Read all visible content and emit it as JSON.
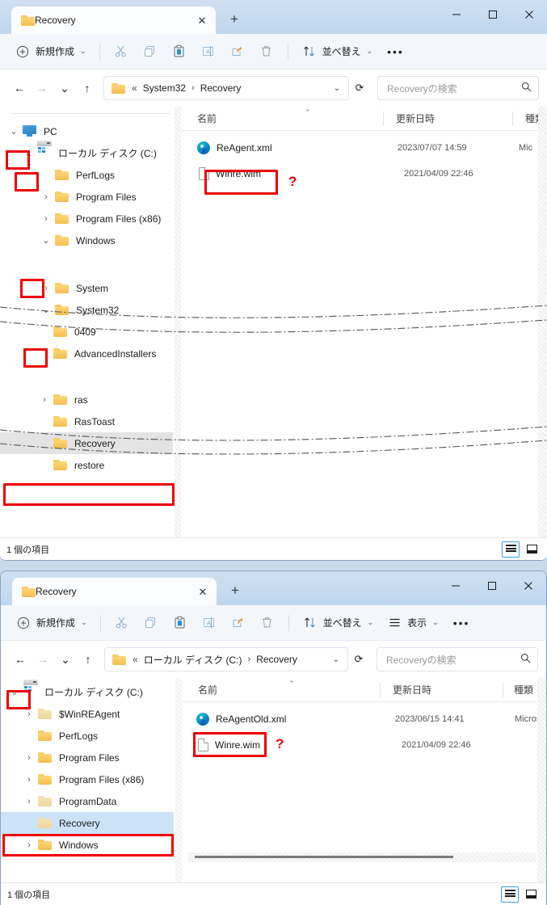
{
  "windows": [
    {
      "id": "window-system32-recovery",
      "tab": {
        "title": "Recovery",
        "close_label": "✕",
        "newtab_label": "+"
      },
      "window_controls": {
        "minimize": "–",
        "maximize": "□",
        "close": "✕"
      },
      "toolbar": {
        "new_label": "新規作成",
        "new_chevron": "⌄",
        "cut_label": "切り取り",
        "copy_label": "コピー",
        "paste_label": "貼り付け",
        "rename_label": "名前の変更",
        "share_label": "共有",
        "delete_label": "削除",
        "sort_label": "並べ替え",
        "sort_chevron": "⌄",
        "more_label": "•••"
      },
      "address": {
        "back": "←",
        "forward": "→",
        "recent": "⌄",
        "up": "↑",
        "crumb_prefix": "«",
        "crumbs": [
          "System32",
          "Recovery"
        ],
        "crumb_separator": "›",
        "dropdown": "⌄",
        "refresh": "⟳",
        "search_placeholder": "Recoveryの検索",
        "search_icon": "⚲"
      },
      "tree": [
        {
          "label": "PC",
          "indent": 1,
          "twisty": "down",
          "icon": "pc",
          "highlight_twisty": true
        },
        {
          "label": "ローカル ディスク (C:)",
          "indent": 2,
          "twisty": "down",
          "icon": "disk",
          "highlight_twisty": true
        },
        {
          "label": "PerfLogs",
          "indent": 3,
          "twisty": "none",
          "icon": "folder"
        },
        {
          "label": "Program Files",
          "indent": 3,
          "twisty": "right",
          "icon": "folder"
        },
        {
          "label": "Program Files (x86)",
          "indent": 3,
          "twisty": "right",
          "icon": "folder"
        },
        {
          "label": "Windows",
          "indent": 3,
          "twisty": "down",
          "icon": "folder",
          "highlight_twisty": true
        },
        {
          "label": "System",
          "indent": 3,
          "twisty": "right",
          "icon": "folder"
        },
        {
          "label": "System32",
          "indent": 3,
          "twisty": "down",
          "icon": "folder",
          "highlight_twisty": true
        },
        {
          "label": "0409",
          "indent": 4,
          "twisty": "none",
          "icon": "folder"
        },
        {
          "label": "AdvancedInstallers",
          "indent": 4,
          "twisty": "none",
          "icon": "folder"
        },
        {
          "label": "ras",
          "indent": 4,
          "twisty": "right",
          "icon": "folder"
        },
        {
          "label": "RasToast",
          "indent": 4,
          "twisty": "none",
          "icon": "folder"
        },
        {
          "label": "Recovery",
          "indent": 4,
          "twisty": "none",
          "icon": "folder",
          "selected": "grey",
          "highlight_row": true
        },
        {
          "label": "restore",
          "indent": 4,
          "twisty": "none",
          "icon": "folder"
        }
      ],
      "columns": [
        "名前",
        "更新日時",
        "種類"
      ],
      "sort_caret": "⌃",
      "files": [
        {
          "name": "ReAgent.xml",
          "icon": "edge",
          "date": "2023/07/07  14:59",
          "type": "Mic"
        },
        {
          "name": "Winre.wim",
          "icon": "file",
          "date": "2021/04/09  22:46",
          "type": "",
          "highlight": true,
          "marker": "?"
        }
      ],
      "status": {
        "text": "1 個の項目"
      },
      "view_buttons": {
        "details_icon": "details-view-icon",
        "tiles_icon": "tiles-view-icon"
      }
    },
    {
      "id": "window-c-recovery",
      "tab": {
        "title": "Recovery",
        "close_label": "✕",
        "newtab_label": "+"
      },
      "window_controls": {
        "minimize": "–",
        "maximize": "□",
        "close": "✕"
      },
      "toolbar": {
        "new_label": "新規作成",
        "new_chevron": "⌄",
        "cut_label": "切り取り",
        "copy_label": "コピー",
        "paste_label": "貼り付け",
        "rename_label": "名前の変更",
        "share_label": "共有",
        "delete_label": "削除",
        "sort_label": "並べ替え",
        "sort_chevron": "⌄",
        "view_label": "表示",
        "view_chevron": "⌄",
        "more_label": "•••"
      },
      "address": {
        "back": "←",
        "forward": "→",
        "recent": "⌄",
        "up": "↑",
        "crumb_prefix": "«",
        "crumbs": [
          "ローカル ディスク (C:)",
          "Recovery"
        ],
        "crumb_separator": "›",
        "dropdown": "⌄",
        "refresh": "⟳",
        "search_placeholder": "Recoveryの検索",
        "search_icon": "⚲"
      },
      "tree": [
        {
          "label": "ローカル ディスク (C:)",
          "indent": 1,
          "twisty": "down",
          "icon": "disk",
          "highlight_twisty": true
        },
        {
          "label": "$WinREAgent",
          "indent": 2,
          "twisty": "right",
          "icon": "folder-dim"
        },
        {
          "label": "PerfLogs",
          "indent": 2,
          "twisty": "none",
          "icon": "folder"
        },
        {
          "label": "Program Files",
          "indent": 2,
          "twisty": "right",
          "icon": "folder"
        },
        {
          "label": "Program Files (x86)",
          "indent": 2,
          "twisty": "right",
          "icon": "folder"
        },
        {
          "label": "ProgramData",
          "indent": 2,
          "twisty": "right",
          "icon": "folder-dim"
        },
        {
          "label": "Recovery",
          "indent": 2,
          "twisty": "none",
          "icon": "folder-dim",
          "selected": "blue",
          "highlight_row": true
        },
        {
          "label": "Windows",
          "indent": 2,
          "twisty": "right",
          "icon": "folder"
        }
      ],
      "columns": [
        "名前",
        "更新日時",
        "種類"
      ],
      "sort_caret": "⌃",
      "files": [
        {
          "name": "ReAgentOld.xml",
          "icon": "edge",
          "date": "2023/06/15  14:41",
          "type": "Microsoft"
        },
        {
          "name": "Winre.wim",
          "icon": "file",
          "date": "2021/04/09  22:46",
          "type": "",
          "highlight": true,
          "marker": "?"
        }
      ],
      "status": {
        "text": "1 個の項目"
      },
      "view_buttons": {
        "details_icon": "details-view-icon",
        "tiles_icon": "tiles-view-icon"
      }
    }
  ],
  "annotation": {
    "box_color": "#ee0000",
    "marker": "?",
    "tear_line_style": "dash-dot"
  }
}
